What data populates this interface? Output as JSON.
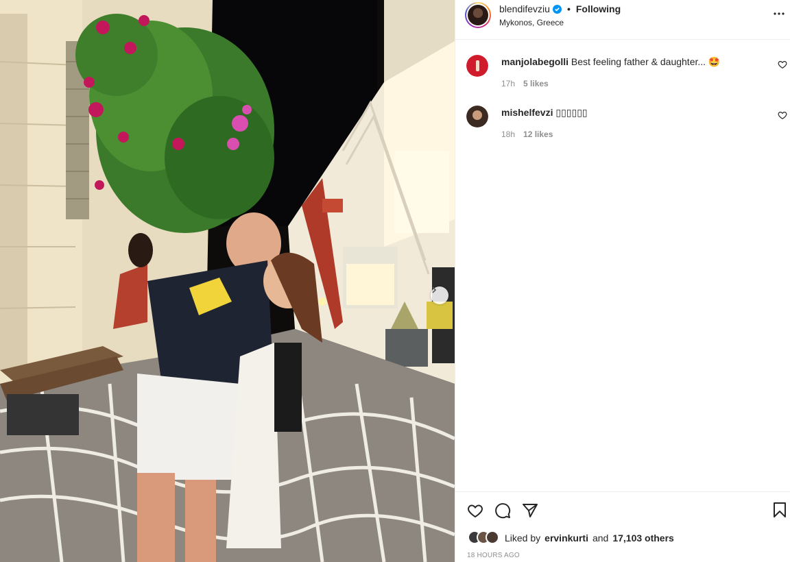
{
  "post": {
    "username": "blendifevziu",
    "separator": "•",
    "follow_label": "Following",
    "location": "Mykonos, Greece",
    "more_icon": "more-horizontal-icon",
    "verified_icon": "verified-badge-icon"
  },
  "comments": [
    {
      "username": "manjolabegolli",
      "text": "Best feeling father & daughter... 🤩",
      "time": "17h",
      "likes": "5 likes"
    },
    {
      "username": "mishelfevzi",
      "text": "▯▯▯▯▯▯",
      "time": "18h",
      "likes": "12 likes"
    }
  ],
  "footer": {
    "liked_prefix": "Liked by",
    "liked_user": "ervinkurti",
    "liked_and": "and",
    "liked_others": "17,103 others",
    "timestamp": "18 HOURS AGO"
  },
  "colors": {
    "accent": "#0095f6",
    "muted": "#8e8e8e",
    "text": "#262626",
    "border": "#efefef"
  }
}
